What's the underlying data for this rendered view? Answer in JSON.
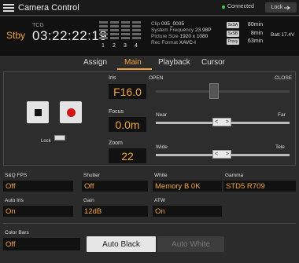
{
  "header": {
    "title": "Camera Control",
    "connection": "Connected",
    "lock_label": "Lock"
  },
  "status": {
    "state": "Stby",
    "tcg_label": "TCG",
    "timecode": "03:22:22:19",
    "meter_numbers": [
      "1",
      "2",
      "3",
      "4"
    ],
    "clip_rows": [
      {
        "k": "Clip ",
        "v": "005_0005"
      },
      {
        "k": "System Frequency ",
        "v": "23.98P"
      },
      {
        "k": "Picture Size ",
        "v": "1920 x 1080"
      },
      {
        "k": "Rec Format ",
        "v": "XAVC-I"
      }
    ],
    "media": [
      {
        "badge": "SxSA",
        "value": "80min"
      },
      {
        "badge": "SxSB",
        "value": "8min"
      },
      {
        "badge": "Proxy",
        "value": "63min"
      }
    ],
    "battery": "Batt 17.4V"
  },
  "tabs": [
    "Assign",
    "Main",
    "Playback",
    "Cursor"
  ],
  "active_tab": "Main",
  "lock_toggle_label": "Lock",
  "iris": {
    "label": "Iris",
    "value": "F16.0",
    "open_label": "OPEN",
    "close_label": "CLOSE"
  },
  "focus": {
    "label": "Focus",
    "value": "0.0m",
    "near_label": "Near",
    "far_label": "Far"
  },
  "zoom": {
    "label": "Zoom",
    "value": "22",
    "wide_label": "Wide",
    "tele_label": "Tele"
  },
  "thumb_arrows": {
    "left": "<",
    "right": ">"
  },
  "settings": {
    "sq_fps": {
      "label": "S&Q FPS",
      "value": "Off"
    },
    "shutter": {
      "label": "Shutter",
      "value": "Off"
    },
    "white": {
      "label": "White",
      "value": "Memory B 0K"
    },
    "gamma": {
      "label": "Gamma",
      "value": "STD5 R709"
    },
    "auto_iris": {
      "label": "Auto Iris",
      "value": "On"
    },
    "gain": {
      "label": "Gain",
      "value": "12dB"
    },
    "atw": {
      "label": "ATW",
      "value": "On"
    },
    "color_bars": {
      "label": "Color Bars",
      "value": "Off"
    }
  },
  "buttons": {
    "auto_black": "Auto Black",
    "auto_white": "Auto White"
  },
  "colors": {
    "accent": "#f2a33a",
    "stby": "#f2a33a",
    "record": "#d21414",
    "connected": "#3dd44e"
  }
}
